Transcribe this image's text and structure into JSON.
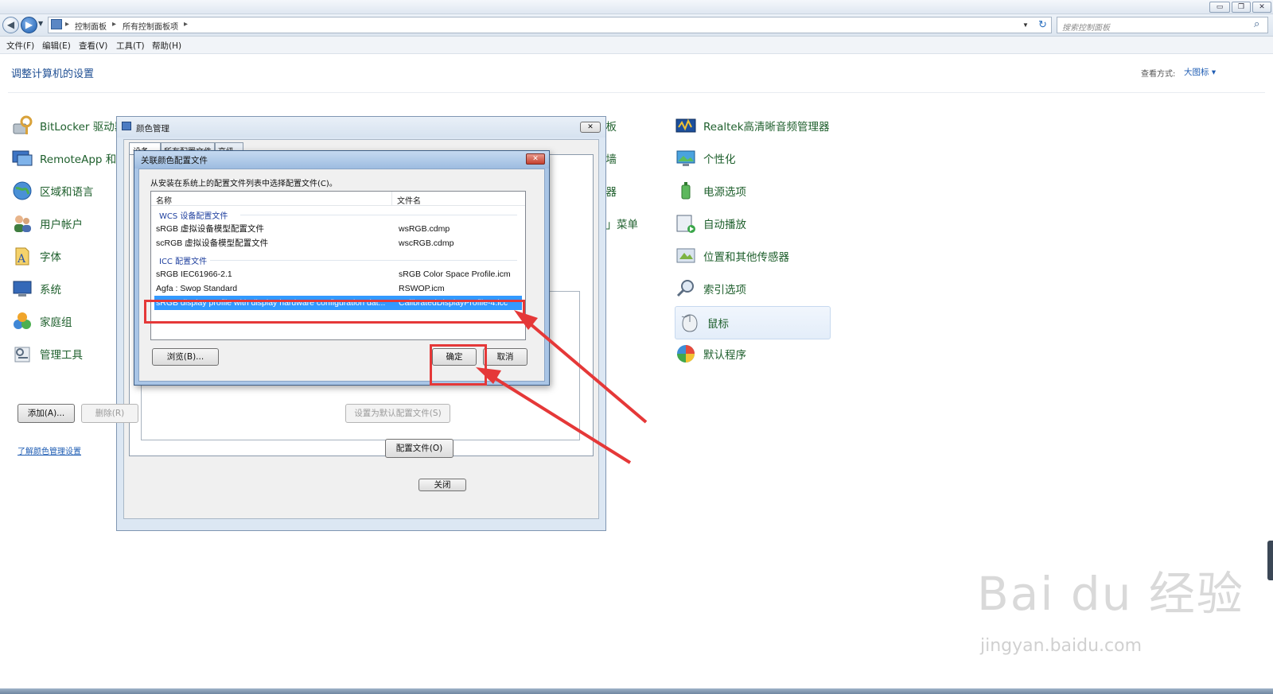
{
  "window": {
    "minimize": "▭",
    "restore": "❐",
    "close": "✕"
  },
  "address": {
    "crumbs": [
      "控制面板",
      "所有控制面板项"
    ],
    "search_placeholder": "搜索控制面板"
  },
  "menu": [
    "文件(F)",
    "编辑(E)",
    "查看(V)",
    "工具(T)",
    "帮助(H)"
  ],
  "page": {
    "title": "调整计算机的设置",
    "view_label": "查看方式:",
    "view_value": "大图标 ▾"
  },
  "items_left": [
    "BitLocker 驱动器",
    "RemoteApp 和",
    "区域和语言",
    "用户帐户",
    "字体",
    "系统",
    "家庭组",
    "管理工具"
  ],
  "items_mid": [
    "面板",
    "火墙",
    "调器",
    "台」菜单"
  ],
  "items_right": [
    "Realtek高清晰音频管理器",
    "个性化",
    "电源选项",
    "自动播放",
    "位置和其他传感器",
    "索引选项",
    "鼠标",
    "默认程序"
  ],
  "color_mgmt": {
    "title": "颜色管理",
    "tabs": [
      "设备",
      "所有配置文件",
      "高级"
    ],
    "add": "添加(A)...",
    "remove": "删除(R)",
    "set_default": "设置为默认配置文件(S)",
    "learn_link": "了解颜色管理设置",
    "profiles": "配置文件(O)",
    "close": "关闭"
  },
  "dialog": {
    "title": "关联颜色配置文件",
    "instruction": "从安装在系统上的配置文件列表中选择配置文件(C)。",
    "col_name": "名称",
    "col_file": "文件名",
    "group1": "WCS 设备配置文件",
    "group2": "ICC 配置文件",
    "rows": [
      {
        "name": "sRGB 虚拟设备模型配置文件",
        "file": "wsRGB.cdmp"
      },
      {
        "name": "scRGB 虚拟设备模型配置文件",
        "file": "wscRGB.cdmp"
      },
      {
        "name": "sRGB IEC61966-2.1",
        "file": "sRGB Color Space Profile.icm"
      },
      {
        "name": "Agfa : Swop Standard",
        "file": "RSWOP.icm"
      },
      {
        "name": "sRGB display profile with display hardware configuration dat...",
        "file": "CalibratedDisplayProfile-4.icc"
      }
    ],
    "browse": "浏览(B)...",
    "ok": "确定",
    "cancel": "取消"
  },
  "watermark": {
    "brand": "Bai du 经验",
    "url": "jingyan.baidu.com"
  },
  "colors": {
    "accent": "#1e5cb3",
    "item_text": "#1e5f2c",
    "selection": "#3399ff",
    "annotation": "#e53838"
  }
}
